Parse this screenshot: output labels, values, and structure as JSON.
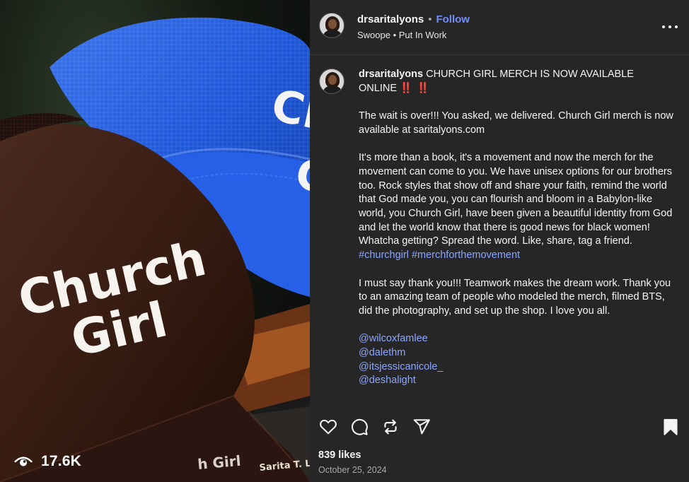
{
  "post": {
    "username": "drsaritalyons",
    "follow_label": "Follow",
    "audio": "Swoope • Put In Work",
    "media": {
      "hat_front_text_line1": "Church",
      "hat_front_text_line2": "Girl",
      "hat_back_text": "Ch",
      "book_text_1": "h Girl",
      "book_text_2": "Sarita T. Ly",
      "views_count": "17.6K",
      "icons": {
        "views": "eye-icon"
      }
    },
    "caption": {
      "username": "drsaritalyons",
      "headline": "CHURCH GIRL MERCH IS NOW AVAILABLE ONLINE",
      "headline_emoji": "‼️ ‼️",
      "para1": "The wait is over!!! You asked, we delivered. Church Girl merch is now available at saritalyons.com",
      "para2": "It's more than a book, it's a movement and now the merch for the movement can come to you. We have unisex options for our brothers too. Rock styles that show off and share your faith, remind the world that God made you, you can flourish and bloom in a Babylon-like world, you Church Girl, have been given a beautiful identity from God and let the world know that there is good news for black women! Whatcha getting? Spread the word. Like, share, tag a friend.",
      "hashtags": [
        "#churchgirl",
        "#merchforthemovement"
      ],
      "para3": "I must say thank you!!! Teamwork makes the dream work. Thank you to an amazing team of people who modeled the merch, filmed BTS, did the photography, and set up the shop. I love you all.",
      "mentions": [
        "@wilcoxfamlee",
        "@dalethm",
        "@itsjessicanicole_",
        "@deshalight"
      ]
    },
    "likes": "839 likes",
    "date": "October 25, 2024",
    "icons": {
      "like": "heart-icon",
      "comment": "comment-icon",
      "repost": "repost-icon",
      "share": "send-icon",
      "save": "bookmark-icon",
      "more": "more-options-icon"
    },
    "colors": {
      "panel_bg": "#262626",
      "link": "#8aa6ff",
      "follow": "#6f8eff",
      "hat_front": "#3a2118",
      "hat_back": "#1d55d6"
    }
  }
}
